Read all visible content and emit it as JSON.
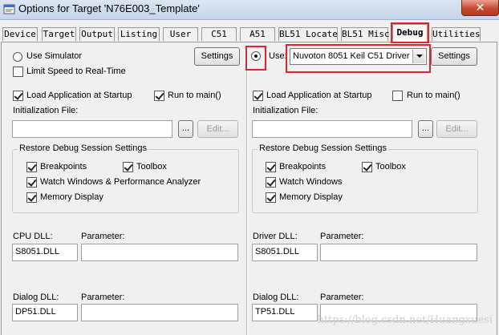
{
  "window": {
    "title": "Options for Target 'N76E003_Template'",
    "close_glyph": "✕"
  },
  "tabs": [
    {
      "label": "Device"
    },
    {
      "label": "Target"
    },
    {
      "label": "Output"
    },
    {
      "label": "Listing"
    },
    {
      "label": "User"
    },
    {
      "label": "C51"
    },
    {
      "label": "A51"
    },
    {
      "label": "BL51 Locate"
    },
    {
      "label": "BL51 Misc"
    },
    {
      "label": "Debug"
    },
    {
      "label": "Utilities"
    }
  ],
  "active_tab": "Debug",
  "left": {
    "use_simulator": "Use Simulator",
    "limit_speed": "Limit Speed to Real-Time",
    "settings": "Settings",
    "load_app": "Load Application at Startup",
    "run_to_main": "Run to main()",
    "init_file": "Initialization File:",
    "browse": "...",
    "edit": "Edit...",
    "restore_group": "Restore Debug Session Settings",
    "breakpoints": "Breakpoints",
    "toolbox": "Toolbox",
    "watch": "Watch Windows & Performance Analyzer",
    "memory": "Memory Display",
    "dll_label": "CPU DLL:",
    "param_label": "Parameter:",
    "dll_value": "S8051.DLL",
    "dialog_label": "Dialog DLL:",
    "dialog_param_label": "Parameter:",
    "dialog_value": "DP51.DLL"
  },
  "right": {
    "use": "Use:",
    "driver": "Nuvoton 8051 Keil C51 Driver",
    "settings": "Settings",
    "load_app": "Load Application at Startup",
    "run_to_main": "Run to main()",
    "init_file": "Initialization File:",
    "browse": "...",
    "edit": "Edit...",
    "restore_group": "Restore Debug Session Settings",
    "breakpoints": "Breakpoints",
    "toolbox": "Toolbox",
    "watch": "Watch Windows",
    "memory": "Memory Display",
    "dll_label": "Driver DLL:",
    "param_label": "Parameter:",
    "dll_value": "S8051.DLL",
    "dialog_label": "Dialog DLL:",
    "dialog_param_label": "Parameter:",
    "dialog_value": "TP51.DLL"
  },
  "watermark": "https://blog.csdn.net/Huangxuesi",
  "colors": {
    "highlight": "#e0242c",
    "titlebar": "#c4d5ea",
    "close": "#c74a35"
  }
}
